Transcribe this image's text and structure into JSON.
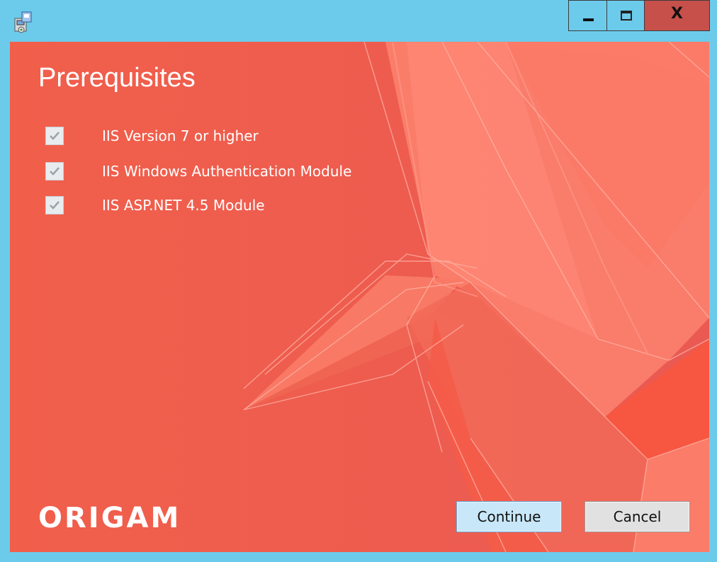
{
  "window": {
    "app_icon": "installer-icon",
    "controls": {
      "minimize_icon": "minimize-icon",
      "maximize_icon": "maximize-icon",
      "close_label": "X"
    }
  },
  "page": {
    "title": "Prerequisites",
    "prerequisites": [
      {
        "label": "IIS Version 7 or higher",
        "checked": true,
        "enabled": false
      },
      {
        "label": "IIS Windows Authentication Module",
        "checked": true,
        "enabled": false
      },
      {
        "label": "IIS ASP.NET 4.5 Module",
        "checked": true,
        "enabled": false
      }
    ],
    "logo_text": "ORIGAM"
  },
  "buttons": {
    "continue_label": "Continue",
    "cancel_label": "Cancel"
  },
  "colors": {
    "titlebar": "#6ccbeb",
    "background": "#ef5d4d",
    "close_button": "#c7504b",
    "continue_button": "#c8e7f9"
  }
}
